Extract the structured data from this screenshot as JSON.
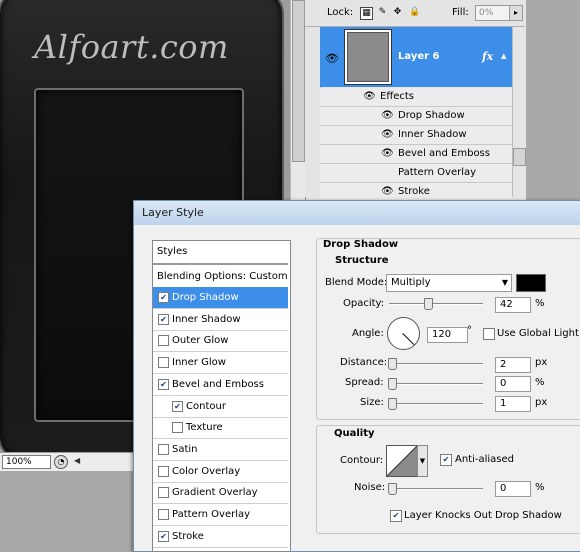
{
  "canvas": {
    "watermark": "Alfoart.com",
    "zoom": "100%"
  },
  "layers_panel": {
    "lock_label": "Lock:",
    "fill_label": "Fill:",
    "fill_value": "0%",
    "layer_name": "Layer 6",
    "fx": "fx",
    "effects_label": "Effects",
    "effects": [
      "Drop Shadow",
      "Inner Shadow",
      "Bevel and Emboss",
      "Pattern Overlay",
      "Stroke"
    ]
  },
  "dialog": {
    "title": "Layer Style",
    "styles_header": "Styles",
    "blending": "Blending Options: Custom",
    "styles": [
      {
        "label": "Drop Shadow",
        "checked": true,
        "selected": true
      },
      {
        "label": "Inner Shadow",
        "checked": true
      },
      {
        "label": "Outer Glow",
        "checked": false
      },
      {
        "label": "Inner Glow",
        "checked": false
      },
      {
        "label": "Bevel and Emboss",
        "checked": true
      },
      {
        "label": "Contour",
        "checked": true,
        "indent": true
      },
      {
        "label": "Texture",
        "checked": false,
        "indent": true
      },
      {
        "label": "Satin",
        "checked": false
      },
      {
        "label": "Color Overlay",
        "checked": false
      },
      {
        "label": "Gradient Overlay",
        "checked": false
      },
      {
        "label": "Pattern Overlay",
        "checked": false
      },
      {
        "label": "Stroke",
        "checked": true
      }
    ],
    "drop_shadow": {
      "heading": "Drop Shadow",
      "structure": "Structure",
      "blend_mode_label": "Blend Mode:",
      "blend_mode": "Multiply",
      "shadow_color": "#000000",
      "opacity_label": "Opacity:",
      "opacity": "42",
      "opacity_fraction": 0.42,
      "percent": "%",
      "angle_label": "Angle:",
      "angle": "120",
      "degree": "°",
      "global_light": "Use Global Light",
      "distance_label": "Distance:",
      "distance": "2",
      "spread_label": "Spread:",
      "spread": "0",
      "size_label": "Size:",
      "size": "1",
      "px": "px"
    },
    "quality": {
      "heading": "Quality",
      "contour_label": "Contour:",
      "anti_aliased": "Anti-aliased",
      "noise_label": "Noise:",
      "noise": "0",
      "knockout": "Layer Knocks Out Drop Shadow"
    }
  },
  "colors": {
    "selection": "#3d8ee8",
    "dialog_bg": "#f0f0f0"
  }
}
